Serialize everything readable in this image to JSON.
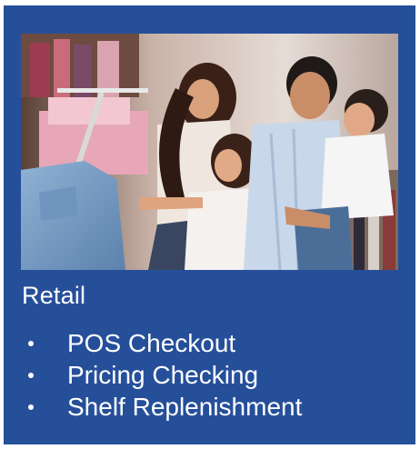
{
  "card": {
    "background": "#264f9a",
    "image_alt": "family-shopping-photo",
    "title": "Retail",
    "items": [
      {
        "label": "POS Checkout"
      },
      {
        "label": "Pricing Checking"
      },
      {
        "label": "Shelf Replenishment"
      }
    ]
  }
}
